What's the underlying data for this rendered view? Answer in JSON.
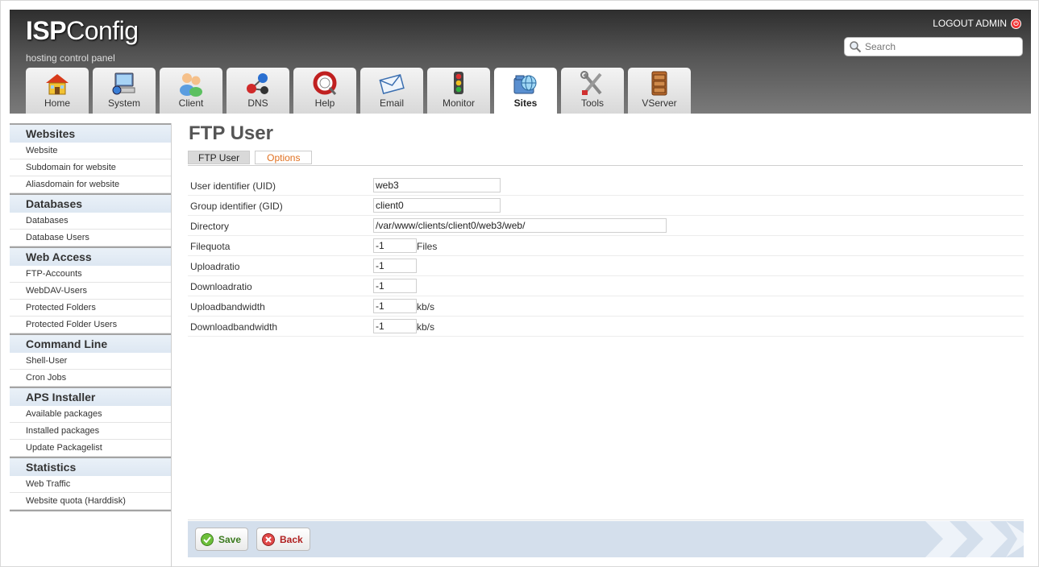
{
  "header": {
    "logo_prefix": "ISP",
    "logo_suffix": "Config",
    "tagline": "hosting control panel",
    "logout": "LOGOUT ADMIN",
    "search_placeholder": "Search"
  },
  "tabs": [
    {
      "label": "Home",
      "icon": "home-icon"
    },
    {
      "label": "System",
      "icon": "system-icon"
    },
    {
      "label": "Client",
      "icon": "client-icon"
    },
    {
      "label": "DNS",
      "icon": "dns-icon"
    },
    {
      "label": "Help",
      "icon": "help-icon"
    },
    {
      "label": "Email",
      "icon": "email-icon"
    },
    {
      "label": "Monitor",
      "icon": "monitor-icon"
    },
    {
      "label": "Sites",
      "icon": "sites-icon",
      "active": true
    },
    {
      "label": "Tools",
      "icon": "tools-icon"
    },
    {
      "label": "VServer",
      "icon": "vserver-icon"
    }
  ],
  "sidebar": {
    "sections": [
      {
        "title": "Websites",
        "items": [
          "Website",
          "Subdomain for website",
          "Aliasdomain for website"
        ]
      },
      {
        "title": "Databases",
        "items": [
          "Databases",
          "Database Users"
        ]
      },
      {
        "title": "Web Access",
        "items": [
          "FTP-Accounts",
          "WebDAV-Users",
          "Protected Folders",
          "Protected Folder Users"
        ]
      },
      {
        "title": "Command Line",
        "items": [
          "Shell-User",
          "Cron Jobs"
        ]
      },
      {
        "title": "APS Installer",
        "items": [
          "Available packages",
          "Installed packages",
          "Update Packagelist"
        ]
      },
      {
        "title": "Statistics",
        "items": [
          "Web Traffic",
          "Website quota (Harddisk)"
        ]
      }
    ]
  },
  "main": {
    "title": "FTP User",
    "subtabs": [
      {
        "label": "FTP User",
        "active": true
      },
      {
        "label": "Options",
        "active": false
      }
    ],
    "fields": [
      {
        "label": "User identifier (UID)",
        "value": "web3",
        "suffix": ""
      },
      {
        "label": "Group identifier (GID)",
        "value": "client0",
        "suffix": ""
      },
      {
        "label": "Directory",
        "value": "/var/www/clients/client0/web3/web/",
        "suffix": ""
      },
      {
        "label": "Filequota",
        "value": "-1",
        "suffix": "Files"
      },
      {
        "label": "Uploadratio",
        "value": "-1",
        "suffix": ""
      },
      {
        "label": "Downloadratio",
        "value": "-1",
        "suffix": ""
      },
      {
        "label": "Uploadbandwidth",
        "value": "-1",
        "suffix": "kb/s"
      },
      {
        "label": "Downloadbandwidth",
        "value": "-1",
        "suffix": "kb/s"
      }
    ],
    "buttons": {
      "save": "Save",
      "back": "Back"
    }
  },
  "colors": {
    "save_text": "#3b7a1e",
    "back_text": "#b02020",
    "options_tab_text": "#e07020",
    "footer_bar": "#d4dfec"
  }
}
